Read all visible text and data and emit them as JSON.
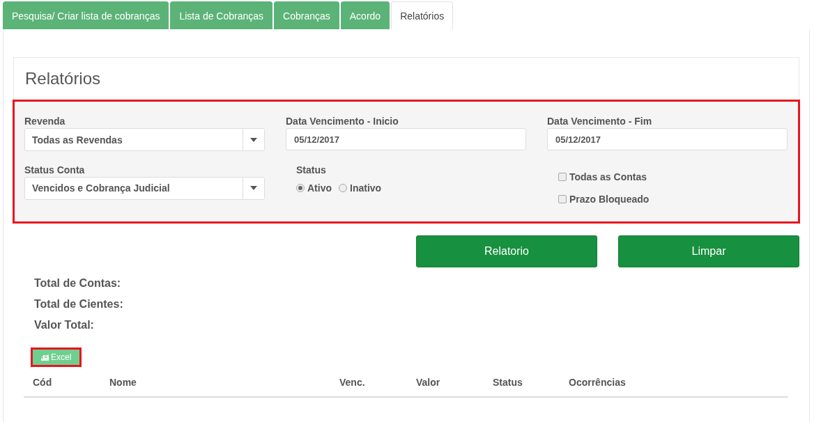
{
  "tabs": [
    {
      "label": "Pesquisa/ Criar lista de cobranças",
      "selected": false
    },
    {
      "label": "Lista de Cobranças",
      "selected": false
    },
    {
      "label": "Cobranças",
      "selected": false
    },
    {
      "label": "Acordo",
      "selected": false
    },
    {
      "label": "Relatórios",
      "selected": true
    }
  ],
  "panel": {
    "title": "Relatórios"
  },
  "filters": {
    "highlighted": true,
    "revenda": {
      "label": "Revenda",
      "value": "Todas as Revendas"
    },
    "data_inicio": {
      "label": "Data Vencimento - Inicio",
      "value": "05/12/2017"
    },
    "data_fim": {
      "label": "Data Vencimento - Fim",
      "value": "05/12/2017"
    },
    "status_conta": {
      "label": "Status Conta",
      "value": "Vencidos e Cobrança Judicial"
    },
    "status": {
      "label": "Status",
      "options": [
        {
          "label": "Ativo",
          "selected": true
        },
        {
          "label": "Inativo",
          "selected": false
        }
      ]
    },
    "checkboxes": [
      {
        "label": "Todas as Contas",
        "checked": false
      },
      {
        "label": "Prazo Bloqueado",
        "checked": false
      }
    ]
  },
  "buttons": [
    "Relatorio",
    "Limpar"
  ],
  "totals": [
    "Total de Contas:",
    "Total de Cientes:",
    "Valor Total:"
  ],
  "excel_button": {
    "label": "Excel",
    "highlighted": true
  },
  "table": {
    "columns": [
      "Cód",
      "Nome",
      "Venc.",
      "Valor",
      "Status",
      "Ocorrências"
    ]
  }
}
